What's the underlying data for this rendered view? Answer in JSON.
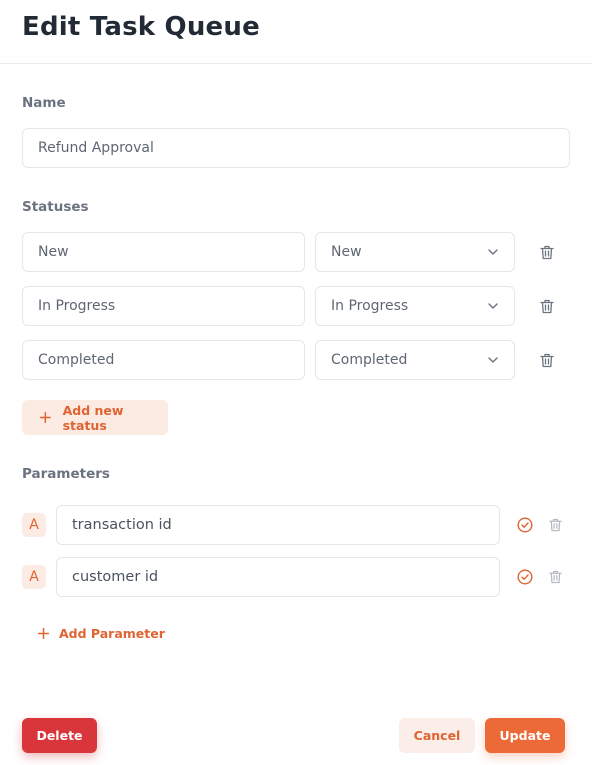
{
  "header": {
    "title": "Edit Task Queue"
  },
  "name_section": {
    "label": "Name",
    "value": "Refund Approval"
  },
  "statuses_section": {
    "label": "Statuses",
    "items": [
      {
        "name": "New",
        "type": "New"
      },
      {
        "name": "In Progress",
        "type": "In Progress"
      },
      {
        "name": "Completed",
        "type": "Completed"
      }
    ],
    "add_label": "Add new status"
  },
  "parameters_section": {
    "label": "Parameters",
    "items": [
      {
        "badge": "A",
        "value": "transaction id"
      },
      {
        "badge": "A",
        "value": "customer id"
      }
    ],
    "add_label": "Add Parameter"
  },
  "footer": {
    "delete_label": "Delete",
    "cancel_label": "Cancel",
    "update_label": "Update"
  },
  "colors": {
    "accent": "#e06332",
    "accent_bg": "#fcebe3",
    "danger": "#d8363b",
    "primary": "#ec6a37"
  },
  "icons": {
    "trash": "trash-icon",
    "chevron": "chevron-down-icon",
    "plus": "plus-icon",
    "check": "check-circle-icon"
  }
}
